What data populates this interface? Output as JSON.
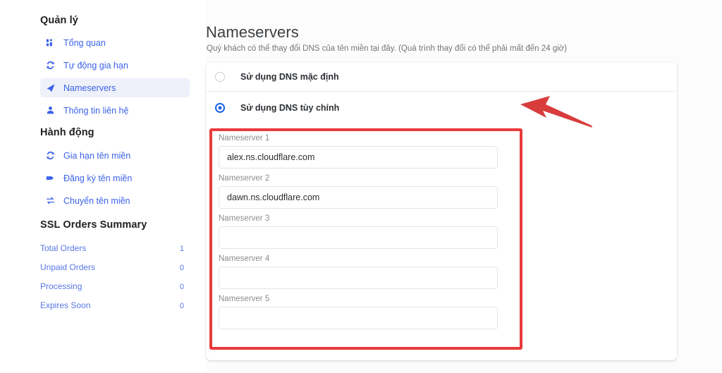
{
  "sidebar": {
    "manage": {
      "heading": "Quản lý",
      "items": [
        {
          "label": "Tổng quan",
          "icon": "dashboard-icon",
          "active": false
        },
        {
          "label": "Tự động gia hạn",
          "icon": "sync-icon",
          "active": false
        },
        {
          "label": "Nameservers",
          "icon": "arrow-icon",
          "active": true
        },
        {
          "label": "Thông tin liên hệ",
          "icon": "person-icon",
          "active": false
        }
      ]
    },
    "action": {
      "heading": "Hành động",
      "items": [
        {
          "label": "Gia hạn tên miền",
          "icon": "sync-icon",
          "active": false
        },
        {
          "label": "Đăng ký tên miền",
          "icon": "tag-icon",
          "active": false
        },
        {
          "label": "Chuyển tên miền",
          "icon": "transfer-icon",
          "active": false
        }
      ]
    },
    "ssl_summary": {
      "heading": "SSL Orders Summary",
      "rows": [
        {
          "label": "Total Orders",
          "value": "1"
        },
        {
          "label": "Unpaid Orders",
          "value": "0"
        },
        {
          "label": "Processing",
          "value": "0"
        },
        {
          "label": "Expires Soon",
          "value": "0"
        }
      ]
    }
  },
  "main": {
    "title": "Nameservers",
    "subtitle": "Quý khách có thể thay đổi DNS của tên miền tại đây. (Quá trình thay đổi có thể phải mất đến 24 giờ)",
    "dns_options": [
      {
        "label": "Sử dụng DNS mặc định",
        "selected": false
      },
      {
        "label": "Sử dụng DNS tùy chỉnh",
        "selected": true
      }
    ],
    "nameservers": [
      {
        "label": "Nameserver 1",
        "value": "alex.ns.cloudflare.com",
        "placeholder": ""
      },
      {
        "label": "Nameserver 2",
        "value": "dawn.ns.cloudflare.com",
        "placeholder": ""
      },
      {
        "label": "Nameserver 3",
        "value": "",
        "placeholder": ""
      },
      {
        "label": "Nameserver 4",
        "value": "",
        "placeholder": ""
      },
      {
        "label": "Nameserver 5",
        "value": "",
        "placeholder": ""
      }
    ]
  },
  "annotations": {
    "highlight_box_color": "#e83b3b",
    "arrow_color": "#d83c3c",
    "arrow_direction": "left"
  },
  "colors": {
    "link_blue": "#3b62e8",
    "radio_blue": "#1a62e3",
    "heading_dark": "#202124",
    "muted_gray": "#70757a",
    "page_background": "#fcfcfd",
    "active_nav_background": "#eef1fa"
  }
}
